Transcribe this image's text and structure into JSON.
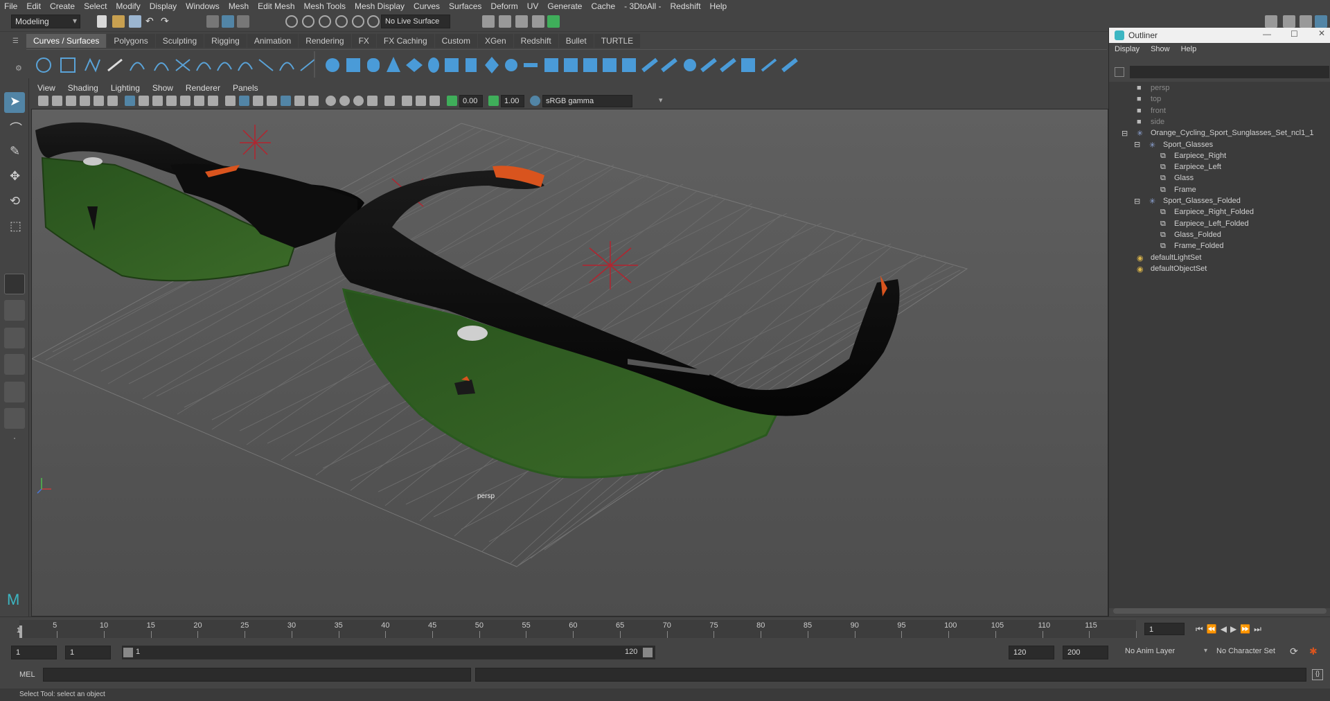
{
  "menu": [
    "File",
    "Edit",
    "Create",
    "Select",
    "Modify",
    "Display",
    "Windows",
    "Mesh",
    "Edit Mesh",
    "Mesh Tools",
    "Mesh Display",
    "Curves",
    "Surfaces",
    "Deform",
    "UV",
    "Generate",
    "Cache",
    "- 3DtoAll -",
    "Redshift",
    "Help"
  ],
  "statusline": {
    "mode": "Modeling",
    "live_surface": "No Live Surface"
  },
  "shelf_tabs": [
    "Curves / Surfaces",
    "Polygons",
    "Sculpting",
    "Rigging",
    "Animation",
    "Rendering",
    "FX",
    "FX Caching",
    "Custom",
    "XGen",
    "Redshift",
    "Bullet",
    "TURTLE"
  ],
  "panel_menu": [
    "View",
    "Shading",
    "Lighting",
    "Show",
    "Renderer",
    "Panels"
  ],
  "panel_toolbar": {
    "exposure": "0.00",
    "gamma": "1.00",
    "color_space": "sRGB gamma"
  },
  "viewport": {
    "camera_label": "persp"
  },
  "outliner": {
    "title": "Outliner",
    "menu": [
      "Display",
      "Show",
      "Help"
    ],
    "items": [
      {
        "label": "persp",
        "type": "camera",
        "indent": 0,
        "dim": true
      },
      {
        "label": "top",
        "type": "camera",
        "indent": 0,
        "dim": true
      },
      {
        "label": "front",
        "type": "camera",
        "indent": 0,
        "dim": true
      },
      {
        "label": "side",
        "type": "camera",
        "indent": 0,
        "dim": true
      },
      {
        "label": "Orange_Cycling_Sport_Sunglasses_Set_ncl1_1",
        "type": "group",
        "indent": 0,
        "dim": false
      },
      {
        "label": "Sport_Glasses",
        "type": "group",
        "indent": 1,
        "dim": false
      },
      {
        "label": "Earpiece_Right",
        "type": "mesh",
        "indent": 2,
        "dim": false
      },
      {
        "label": "Earpiece_Left",
        "type": "mesh",
        "indent": 2,
        "dim": false
      },
      {
        "label": "Glass",
        "type": "mesh",
        "indent": 2,
        "dim": false
      },
      {
        "label": "Frame",
        "type": "mesh",
        "indent": 2,
        "dim": false
      },
      {
        "label": "Sport_Glasses_Folded",
        "type": "group",
        "indent": 1,
        "dim": false
      },
      {
        "label": "Earpiece_Right_Folded",
        "type": "mesh",
        "indent": 2,
        "dim": false
      },
      {
        "label": "Earpiece_Left_Folded",
        "type": "mesh",
        "indent": 2,
        "dim": false
      },
      {
        "label": "Glass_Folded",
        "type": "mesh",
        "indent": 2,
        "dim": false
      },
      {
        "label": "Frame_Folded",
        "type": "mesh",
        "indent": 2,
        "dim": false
      },
      {
        "label": "defaultLightSet",
        "type": "set",
        "indent": 0,
        "dim": false
      },
      {
        "label": "defaultObjectSet",
        "type": "set",
        "indent": 0,
        "dim": false
      }
    ]
  },
  "timeline": {
    "ticks": [
      "5",
      "10",
      "15",
      "20",
      "25",
      "30",
      "35",
      "40",
      "45",
      "50",
      "55",
      "60",
      "65",
      "70",
      "75",
      "80",
      "85",
      "90",
      "95",
      "100",
      "105",
      "110",
      "115"
    ],
    "current_frame": "1",
    "frame_field": "1"
  },
  "range": {
    "start": "1",
    "start2": "1",
    "slider_start": "1",
    "slider_end": "120",
    "end": "120",
    "end2": "200",
    "anim_layer": "No Anim Layer",
    "character_set": "No Character Set"
  },
  "command": {
    "label": "MEL"
  },
  "help": "Select Tool: select an object",
  "colors": {
    "accent": "#5285a6",
    "frame": "#0a0a0a",
    "lens": "#2f5a22",
    "orange": "#d9541e"
  }
}
